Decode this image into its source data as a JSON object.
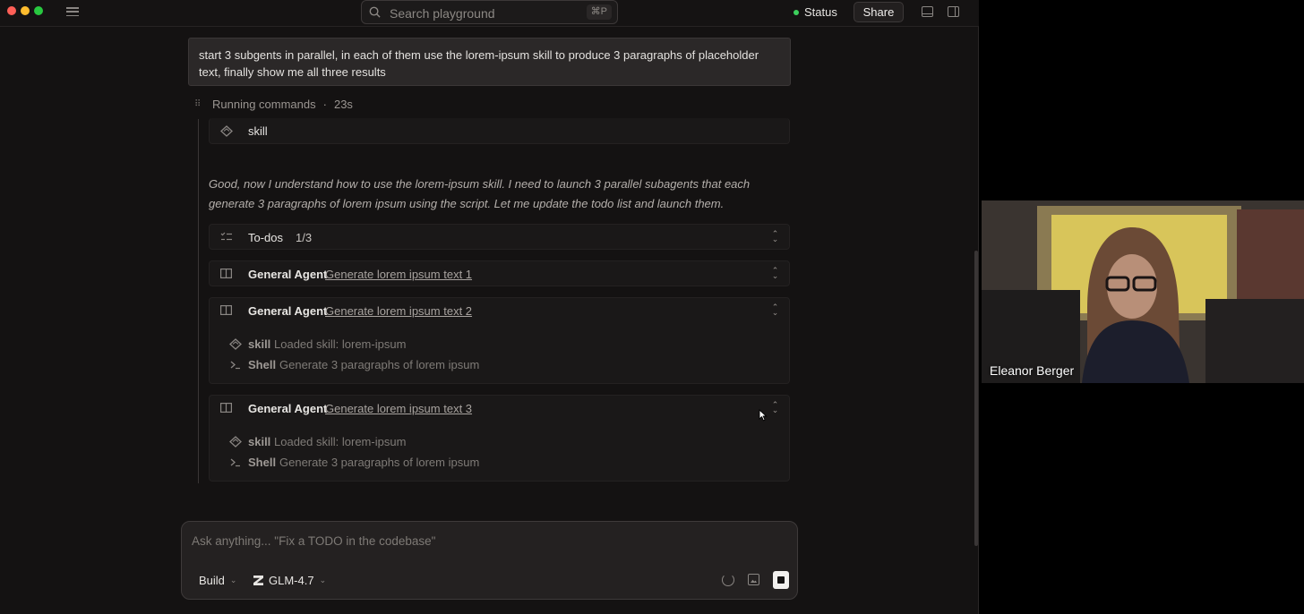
{
  "search": {
    "placeholder": "Search playground",
    "shortcut": "⌘P"
  },
  "header": {
    "status_label": "Status",
    "share_label": "Share"
  },
  "user_message": "start 3 subgents in parallel, in each of them use the lorem-ipsum skill to produce 3 paragraphs of placeholder text, finally show me all three results",
  "running": {
    "label": "Running commands",
    "separator": "·",
    "elapsed": "23s"
  },
  "skill_row": {
    "label": "skill"
  },
  "thought": "Good, now I understand how to use the lorem-ipsum skill. I need to launch 3 parallel subagents that each generate 3 paragraphs of lorem ipsum using the script. Let me update the todo list and launch them.",
  "todos": {
    "label": "To-dos",
    "count": "1/3"
  },
  "agents": [
    {
      "label": "General Agent",
      "task": "Generate lorem ipsum text 1"
    },
    {
      "label": "General Agent",
      "task": "Generate lorem ipsum text 2",
      "steps": [
        {
          "name": "skill",
          "desc": "Loaded skill: lorem-ipsum"
        },
        {
          "name": "Shell",
          "desc": "Generate 3 paragraphs of lorem ipsum"
        }
      ]
    },
    {
      "label": "General Agent",
      "task": "Generate lorem ipsum text 3",
      "steps": [
        {
          "name": "skill",
          "desc": "Loaded skill: lorem-ipsum"
        },
        {
          "name": "Shell",
          "desc": "Generate 3 paragraphs of lorem ipsum"
        }
      ]
    }
  ],
  "composer": {
    "placeholder": "Ask anything... \"Fix a TODO in the codebase\"",
    "mode": "Build",
    "model": "GLM-4.7"
  },
  "video": {
    "participant_name": "Eleanor Berger"
  },
  "colors": {
    "accent_green": "#3ccf5c",
    "background": "#141212",
    "card": "#1a1818"
  }
}
